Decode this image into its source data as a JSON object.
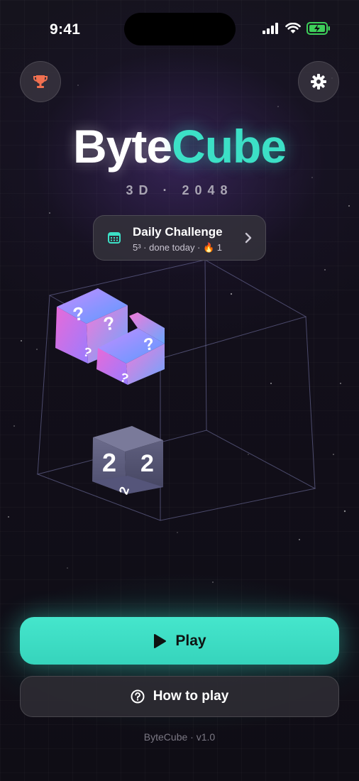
{
  "status_bar": {
    "time": "9:41"
  },
  "title": {
    "part1": "Byte",
    "part2": "Cube",
    "subtitle": "3D · 2048"
  },
  "daily_challenge": {
    "title": "Daily Challenge",
    "subtitle": "5³ · done today · 🔥 1"
  },
  "board": {
    "tiles": [
      {
        "value": "?",
        "style": "mystery"
      },
      {
        "value": "?",
        "style": "mystery"
      },
      {
        "value": "2",
        "style": "number"
      }
    ]
  },
  "buttons": {
    "play": "Play",
    "how_to_play": "How to play"
  },
  "footer": "ByteCube · v1.0",
  "colors": {
    "accent": "#3ce0c6",
    "background": "#13111a",
    "mystery_tile_pink": "#f07ad8",
    "mystery_tile_blue": "#6aa7ff",
    "number_tile": "#5a5a7a"
  },
  "icons": [
    "trophy-icon",
    "gear-icon",
    "calendar-icon",
    "chevron-right-icon",
    "play-icon",
    "help-circle-icon"
  ]
}
